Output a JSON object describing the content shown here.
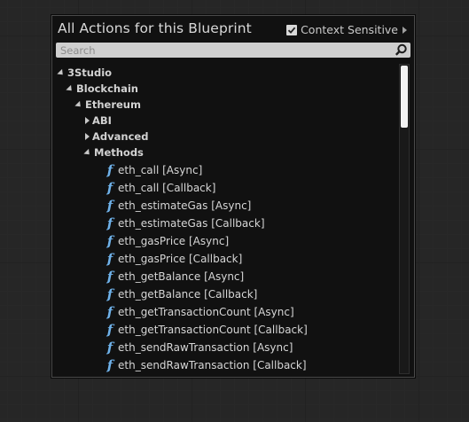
{
  "panel": {
    "title": "All Actions for this Blueprint",
    "context_sensitive_label": "Context Sensitive",
    "context_sensitive_checked": true
  },
  "search": {
    "placeholder": "Search",
    "value": ""
  },
  "tree": {
    "categories": [
      {
        "label": "3Studio",
        "expanded": true
      },
      {
        "label": "Blockchain",
        "expanded": true
      },
      {
        "label": "Ethereum",
        "expanded": true
      },
      {
        "label": "ABI",
        "expanded": false
      },
      {
        "label": "Advanced",
        "expanded": false
      },
      {
        "label": "Methods",
        "expanded": true
      }
    ],
    "functions": [
      "eth_call [Async]",
      "eth_call [Callback]",
      "eth_estimateGas [Async]",
      "eth_estimateGas [Callback]",
      "eth_gasPrice [Async]",
      "eth_gasPrice [Callback]",
      "eth_getBalance [Async]",
      "eth_getBalance [Callback]",
      "eth_getTransactionCount [Async]",
      "eth_getTransactionCount [Callback]",
      "eth_sendRawTransaction [Async]",
      "eth_sendRawTransaction [Callback]"
    ],
    "function_icon": "f"
  },
  "colors": {
    "panel_bg": "#111111",
    "function_icon": "#6fb2ea",
    "search_bg": "#cfcfcf"
  }
}
